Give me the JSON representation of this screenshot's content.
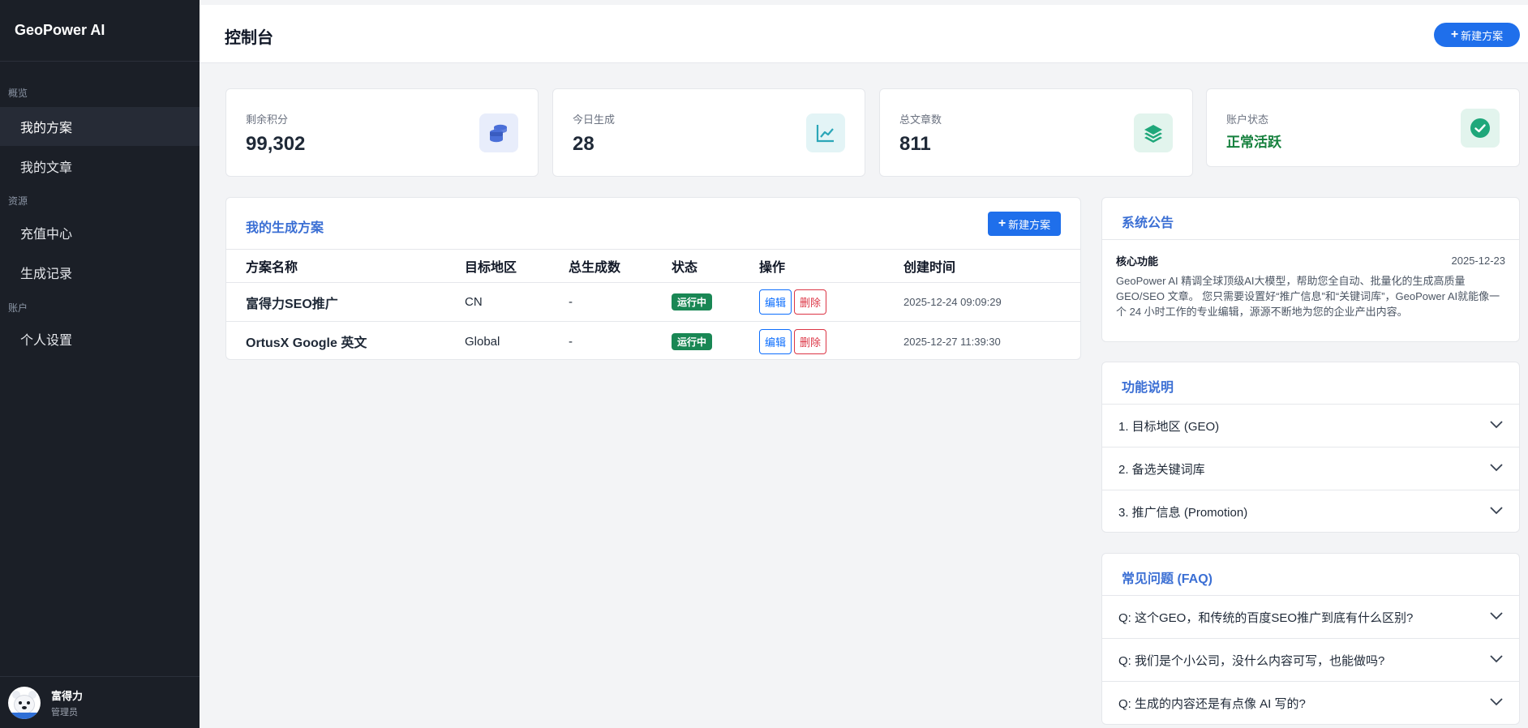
{
  "brand": "GeoPower AI",
  "sidebar": {
    "sections": [
      {
        "label": "概览",
        "items": [
          {
            "label": "我的方案"
          },
          {
            "label": "我的文章"
          }
        ]
      },
      {
        "label": "资源",
        "items": [
          {
            "label": "充值中心"
          },
          {
            "label": "生成记录"
          }
        ]
      },
      {
        "label": "账户",
        "items": [
          {
            "label": "个人设置"
          }
        ]
      }
    ],
    "user": {
      "name": "富得力",
      "role": "管理员"
    }
  },
  "header": {
    "title": "控制台",
    "new_button": "新建方案"
  },
  "stats": [
    {
      "label": "剩余积分",
      "value": "99,302",
      "icon": "coins-icon",
      "color": "#4a6fd8"
    },
    {
      "label": "今日生成",
      "value": "28",
      "icon": "chart-line-icon",
      "color": "#2ba6b8"
    },
    {
      "label": "总文章数",
      "value": "811",
      "icon": "layers-icon",
      "color": "#1fa77a"
    },
    {
      "label": "账户状态",
      "value": "正常活跃",
      "icon": "check-circle-icon",
      "color": "#1fa77a"
    }
  ],
  "plans": {
    "title": "我的生成方案",
    "new_button": "新建方案",
    "columns": [
      "方案名称",
      "目标地区",
      "总生成数",
      "状态",
      "操作",
      "创建时间"
    ],
    "rows": [
      {
        "name": "富得力SEO推广",
        "region": "CN",
        "total": "-",
        "status": "运行中",
        "edit": "编辑",
        "delete": "删除",
        "created": "2025-12-24 09:09:29"
      },
      {
        "name": "OrtusX Google 英文",
        "region": "Global",
        "total": "-",
        "status": "运行中",
        "edit": "编辑",
        "delete": "删除",
        "created": "2025-12-27 11:39:30"
      }
    ]
  },
  "notice": {
    "title": "系统公告",
    "label": "核心功能",
    "date": "2025-12-23",
    "text": "GeoPower AI 精调全球顶级AI大模型，帮助您全自动、批量化的生成高质量GEO/SEO 文章。 您只需要设置好“推广信息”和“关键词库”，GeoPower AI就能像一个 24 小时工作的专业编辑，源源不断地为您的企业产出内容。"
  },
  "features": {
    "title": "功能说明",
    "items": [
      "1. 目标地区 (GEO)",
      "2. 备选关键词库",
      "3. 推广信息 (Promotion)"
    ]
  },
  "faq": {
    "title": "常见问题 (FAQ)",
    "items": [
      "Q: 这个GEO，和传统的百度SEO推广到底有什么区别?",
      "Q: 我们是个小公司，没什么内容可写，也能做吗?",
      "Q: 生成的内容还是有点像 AI 写的?"
    ]
  }
}
